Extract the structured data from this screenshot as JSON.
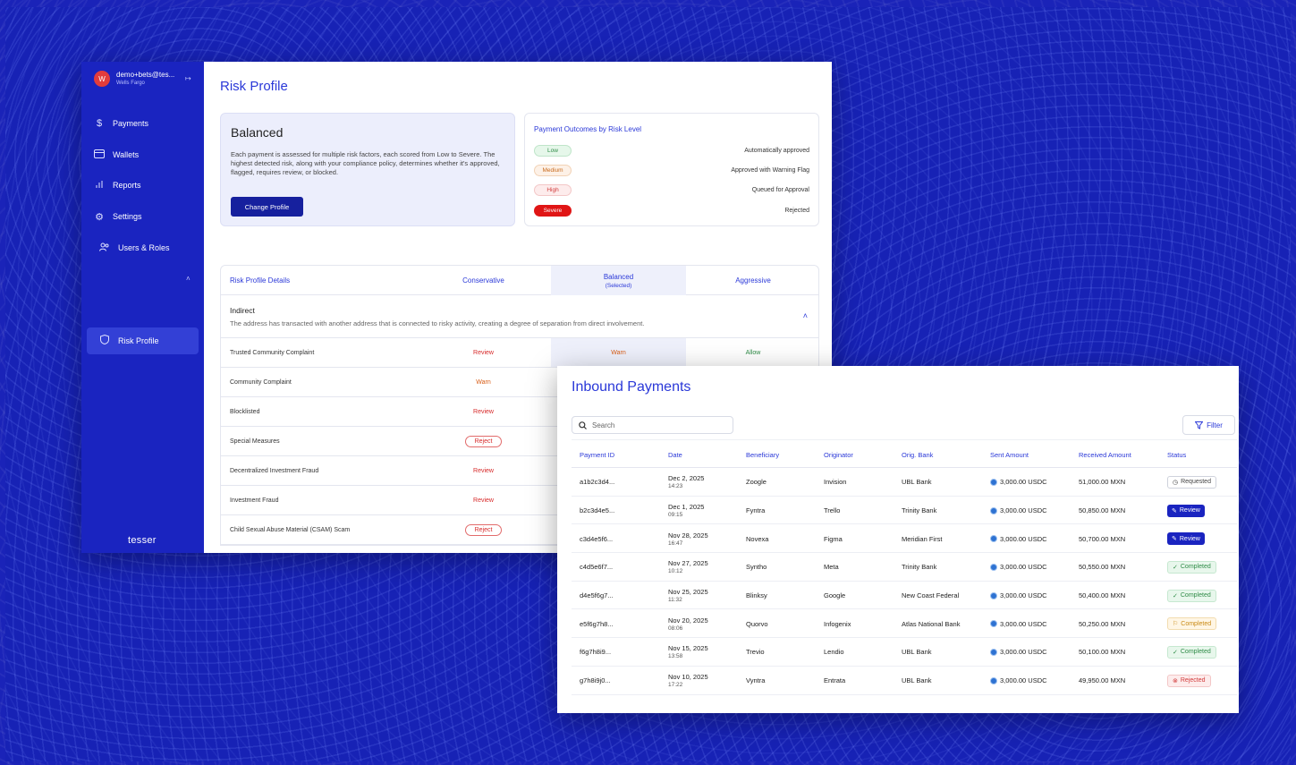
{
  "sidebar": {
    "avatar_letter": "W",
    "user_email": "demo+bets@tes...",
    "user_org": "Wells Fargo",
    "items": [
      {
        "label": "Payments",
        "icon": "dollar-icon"
      },
      {
        "label": "Wallets",
        "icon": "wallet-icon"
      },
      {
        "label": "Reports",
        "icon": "bar-chart-icon"
      },
      {
        "label": "Settings",
        "icon": "gear-icon"
      },
      {
        "label": "Users & Roles",
        "icon": "users-icon"
      },
      {
        "label": "Risk Profile",
        "icon": "shield-icon"
      }
    ],
    "brand": "tesser"
  },
  "risk": {
    "title": "Risk Profile",
    "profile_name": "Balanced",
    "description": "Each payment is assessed for multiple risk factors, each scored from Low to Severe. The highest detected risk, along with your compliance policy, determines whether it's approved, flagged, requires review, or blocked.",
    "change_button": "Change Profile",
    "outcomes_title": "Payment Outcomes by Risk Level",
    "outcomes": [
      {
        "level": "Low",
        "result": "Automatically approved"
      },
      {
        "level": "Medium",
        "result": "Approved with Warning Flag"
      },
      {
        "level": "High",
        "result": "Queued for Approval"
      },
      {
        "level": "Severe",
        "result": "Rejected"
      }
    ],
    "table_headers": {
      "details": "Risk Profile Details",
      "conservative": "Conservative",
      "balanced": "Balanced",
      "balanced_sub": "(Selected)",
      "aggressive": "Aggressive"
    },
    "section_title": "Indirect",
    "section_desc": "The address has transacted with another address that is connected to risky activity, creating a degree of separation from direct involvement.",
    "rows": [
      {
        "label": "Trusted Community Complaint",
        "conservative": "Review",
        "balanced": "Warn",
        "aggressive": "Allow"
      },
      {
        "label": "Community Complaint",
        "conservative": "Warn"
      },
      {
        "label": "Blocklisted",
        "conservative": "Review"
      },
      {
        "label": "Special Measures",
        "conservative": "Reject"
      },
      {
        "label": "Decentralized Investment Fraud",
        "conservative": "Review"
      },
      {
        "label": "Investment Fraud",
        "conservative": "Review"
      },
      {
        "label": "Child Sexual Abuse Material (CSAM) Scam",
        "conservative": "Reject"
      }
    ]
  },
  "payments": {
    "title": "Inbound Payments",
    "search_placeholder": "Search",
    "filter_label": "Filter",
    "headers": [
      "Payment ID",
      "Date",
      "Beneficiary",
      "Originator",
      "Orig. Bank",
      "Sent Amount",
      "Received Amount",
      "Status"
    ],
    "rows": [
      {
        "id": "a1b2c3d4...",
        "date": "Dec 2, 2025",
        "time": "14:23",
        "beneficiary": "Zoogle",
        "originator": "Invision",
        "bank": "UBL Bank",
        "sent": "3,000.00 USDC",
        "received": "51,000.00 MXN",
        "status": "Requested"
      },
      {
        "id": "b2c3d4e5...",
        "date": "Dec 1, 2025",
        "time": "09:15",
        "beneficiary": "Fyntra",
        "originator": "Trello",
        "bank": "Trinity Bank",
        "sent": "3,000.00 USDC",
        "received": "50,850.00 MXN",
        "status": "Review"
      },
      {
        "id": "c3d4e5f6...",
        "date": "Nov 28, 2025",
        "time": "16:47",
        "beneficiary": "Novexa",
        "originator": "Figma",
        "bank": "Meridian First",
        "sent": "3,000.00 USDC",
        "received": "50,700.00 MXN",
        "status": "Review"
      },
      {
        "id": "c4d5e6f7...",
        "date": "Nov 27, 2025",
        "time": "10:12",
        "beneficiary": "Syntho",
        "originator": "Meta",
        "bank": "Trinity Bank",
        "sent": "3,000.00 USDC",
        "received": "50,550.00 MXN",
        "status": "Completed"
      },
      {
        "id": "d4e5f6g7...",
        "date": "Nov 25, 2025",
        "time": "11:32",
        "beneficiary": "Blinksy",
        "originator": "Google",
        "bank": "New Coast Federal",
        "sent": "3,000.00 USDC",
        "received": "50,400.00 MXN",
        "status": "Completed"
      },
      {
        "id": "e5f6g7h8...",
        "date": "Nov 20, 2025",
        "time": "08:06",
        "beneficiary": "Quorvo",
        "originator": "Infogenix",
        "bank": "Atlas National Bank",
        "sent": "3,000.00 USDC",
        "received": "50,250.00 MXN",
        "status": "Completed"
      },
      {
        "id": "f6g7h8i9...",
        "date": "Nov 15, 2025",
        "time": "13:58",
        "beneficiary": "Trevio",
        "originator": "Lendio",
        "bank": "UBL Bank",
        "sent": "3,000.00 USDC",
        "received": "50,100.00 MXN",
        "status": "Completed"
      },
      {
        "id": "g7h8i9j0...",
        "date": "Nov 10, 2025",
        "time": "17:22",
        "beneficiary": "Vyntra",
        "originator": "Entrata",
        "bank": "UBL Bank",
        "sent": "3,000.00 USDC",
        "received": "49,950.00 MXN",
        "status": "Rejected"
      }
    ]
  }
}
